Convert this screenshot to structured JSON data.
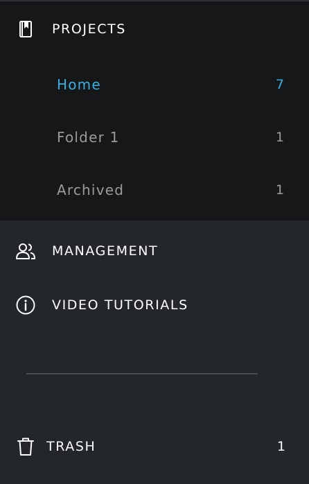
{
  "projects": {
    "label": "PROJECTS",
    "icon": "bookmark-book-icon",
    "items": [
      {
        "label": "Home",
        "count": "7",
        "active": true
      },
      {
        "label": "Folder 1",
        "count": "1",
        "active": false
      },
      {
        "label": "Archived",
        "count": "1",
        "active": false
      }
    ]
  },
  "management": {
    "label": "MANAGEMENT",
    "icon": "users-icon"
  },
  "video_tutorials": {
    "label": "VIDEO TUTORIALS",
    "icon": "info-icon"
  },
  "trash": {
    "label": "TRASH",
    "count": "1",
    "icon": "trash-icon"
  },
  "colors": {
    "accent": "#3aafe0",
    "panel_dark": "#161718",
    "panel": "#23272b",
    "muted_text": "#9a9c9e"
  }
}
